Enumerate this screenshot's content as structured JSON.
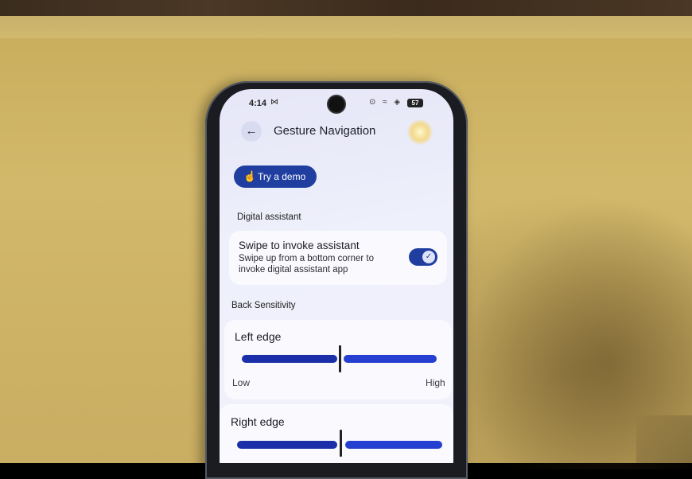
{
  "status": {
    "time": "4:14",
    "msg_icon": "⋈",
    "icons": "⊙ ≈ ◈",
    "battery": "57"
  },
  "header": {
    "title": "Gesture Navigation",
    "back_icon": "←"
  },
  "demo": {
    "label": "Try a demo",
    "icon": "☝"
  },
  "digital_assistant": {
    "section": "Digital assistant",
    "title": "Swipe to invoke assistant",
    "subtitle": "Swipe up from a bottom corner to invoke digital assistant app",
    "enabled": true,
    "check": "✓"
  },
  "back_sensitivity": {
    "section": "Back Sensitivity",
    "left": {
      "title": "Left edge",
      "low": "Low",
      "high": "High",
      "value": 0.5
    },
    "right": {
      "title": "Right edge",
      "value": 0.5
    }
  },
  "colors": {
    "accent": "#1f3ea0",
    "track": "#1a2fa8"
  }
}
